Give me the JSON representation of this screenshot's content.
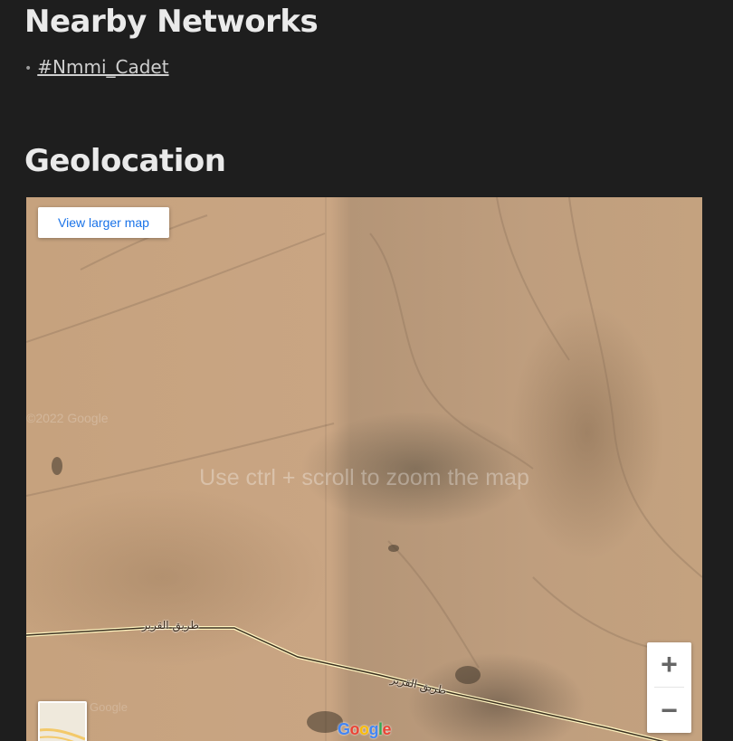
{
  "nearby": {
    "title": "Nearby Networks",
    "networks": [
      "#Nmmi_Cadet"
    ]
  },
  "geolocation": {
    "title": "Geolocation",
    "map": {
      "view_larger_label": "View larger map",
      "overlay_message": "Use ctrl + scroll to zoom the map",
      "copyright_ghost": "©2022 Google",
      "google_ghost": "Google",
      "zoom_in_label": "+",
      "zoom_out_label": "−",
      "road_label": "طريق القرير",
      "logo": [
        "G",
        "o",
        "o",
        "g",
        "l",
        "e"
      ],
      "logo_colors": [
        "#4285f4",
        "#ea4335",
        "#fbbc05",
        "#4285f4",
        "#34a853",
        "#ea4335"
      ],
      "link_color": "#1a73e8"
    }
  }
}
